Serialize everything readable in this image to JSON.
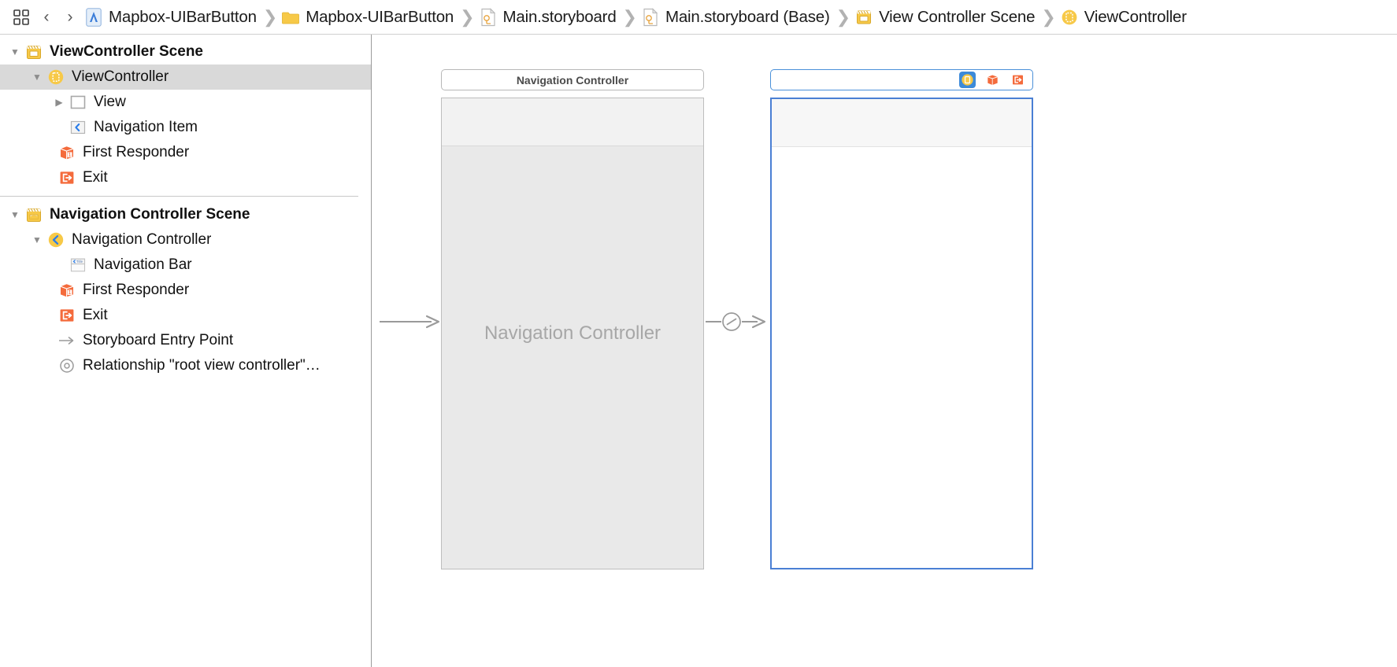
{
  "jumpbar": {
    "grid_icon": "grid-icon",
    "back_label": "‹",
    "forward_label": "›",
    "separator": "❯",
    "crumbs": [
      {
        "label": "Mapbox-UIBarButton",
        "icon": "xcode-project-icon"
      },
      {
        "label": "Mapbox-UIBarButton",
        "icon": "folder-icon"
      },
      {
        "label": "Main.storyboard",
        "icon": "storyboard-file-icon"
      },
      {
        "label": "Main.storyboard (Base)",
        "icon": "storyboard-base-file-icon"
      },
      {
        "label": "View Controller Scene",
        "icon": "scene-icon"
      },
      {
        "label": "ViewController",
        "icon": "view-controller-icon"
      }
    ]
  },
  "outline": {
    "groups": [
      {
        "rows": [
          {
            "label": "ViewController Scene",
            "icon": "scene-icon",
            "indent": 0,
            "twist": "down",
            "bold": true,
            "selected": false
          },
          {
            "label": "ViewController",
            "icon": "view-controller-icon",
            "indent": 1,
            "twist": "down",
            "bold": false,
            "selected": true
          },
          {
            "label": "View",
            "icon": "view-icon",
            "indent": 2,
            "twist": "right",
            "bold": false,
            "selected": false
          },
          {
            "label": "Navigation Item",
            "icon": "navigation-item-icon",
            "indent": 2,
            "twist": "none",
            "bold": false,
            "selected": false
          },
          {
            "label": "First Responder",
            "icon": "first-responder-icon",
            "indent": 1,
            "twist": "none",
            "bold": false,
            "selected": false
          },
          {
            "label": "Exit",
            "icon": "exit-icon",
            "indent": 1,
            "twist": "none",
            "bold": false,
            "selected": false
          }
        ]
      },
      {
        "rows": [
          {
            "label": "Navigation Controller Scene",
            "icon": "scene-icon",
            "indent": 0,
            "twist": "down",
            "bold": true,
            "selected": false
          },
          {
            "label": "Navigation Controller",
            "icon": "navigation-controller-icon",
            "indent": 1,
            "twist": "down",
            "bold": false,
            "selected": false
          },
          {
            "label": "Navigation Bar",
            "icon": "navigation-bar-icon",
            "indent": 2,
            "twist": "none",
            "bold": false,
            "selected": false
          },
          {
            "label": "First Responder",
            "icon": "first-responder-icon",
            "indent": 1,
            "twist": "none",
            "bold": false,
            "selected": false
          },
          {
            "label": "Exit",
            "icon": "exit-icon",
            "indent": 1,
            "twist": "none",
            "bold": false,
            "selected": false
          },
          {
            "label": "Storyboard Entry Point",
            "icon": "entry-point-icon",
            "indent": 1,
            "twist": "none",
            "bold": false,
            "selected": false
          },
          {
            "label": "Relationship \"root view controller\"…",
            "icon": "relationship-icon",
            "indent": 1,
            "twist": "none",
            "bold": false,
            "selected": false
          }
        ]
      }
    ]
  },
  "canvas": {
    "nav_scene": {
      "title": "Navigation Controller",
      "placeholder": "Navigation Controller"
    },
    "vc_scene": {
      "title": "",
      "dock_icons": [
        {
          "name": "view-controller-icon",
          "selected": true
        },
        {
          "name": "first-responder-icon",
          "selected": false
        },
        {
          "name": "exit-icon",
          "selected": false
        }
      ]
    },
    "connectors": [
      {
        "name": "storyboard-entry-point-arrow"
      },
      {
        "name": "relationship-segue-arrow"
      }
    ]
  },
  "colors": {
    "scene_yellow": "#f6c32c",
    "orange": "#f46b3c",
    "blue_select": "#3c8ad9",
    "selection_border": "#4a7fd4",
    "row_selected": "#d9d9d9"
  }
}
